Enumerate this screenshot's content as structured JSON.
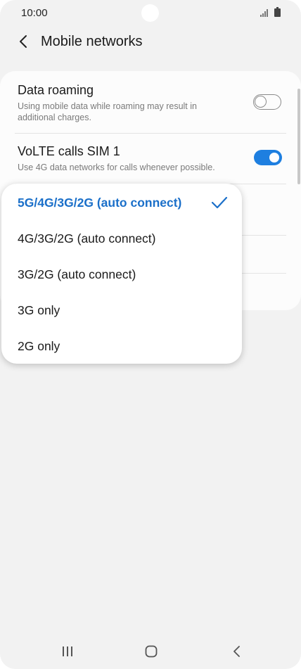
{
  "status_bar": {
    "time": "10:00"
  },
  "header": {
    "title": "Mobile networks"
  },
  "settings": {
    "data_roaming": {
      "title": "Data roaming",
      "subtitle": "Using mobile data while roaming may result in additional charges.",
      "enabled": false
    },
    "volte": {
      "title": "VoLTE calls SIM 1",
      "subtitle": "Use 4G data networks for calls whenever possible.",
      "enabled": true
    }
  },
  "network_mode_popup": {
    "options": [
      "5G/4G/3G/2G (auto connect)",
      "4G/3G/2G (auto connect)",
      "3G/2G (auto connect)",
      "3G only",
      "2G only"
    ],
    "selected_index": 0
  },
  "colors": {
    "accent": "#1e7fe0",
    "selected_text": "#1a6fc9",
    "background": "#f2f2f2",
    "card": "#fcfcfc"
  },
  "icons": {
    "back": "chevron-left-icon",
    "check": "check-icon",
    "recents": "recents-icon",
    "home": "home-icon",
    "nav_back": "nav-back-icon"
  }
}
